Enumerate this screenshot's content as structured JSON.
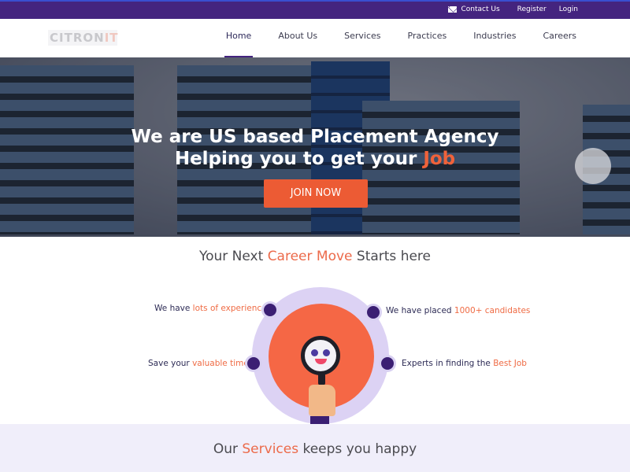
{
  "topbar": {
    "contact_label": "Contact Us",
    "register_label": "Register",
    "login_label": "Login"
  },
  "nav": {
    "logo_main": "CITRON",
    "logo_accent": "IT",
    "items": [
      {
        "label": "Home",
        "active": true
      },
      {
        "label": "About Us"
      },
      {
        "label": "Services"
      },
      {
        "label": "Practices"
      },
      {
        "label": "Industries"
      },
      {
        "label": "Careers"
      }
    ]
  },
  "hero": {
    "line1": "We are US based Placement Agency",
    "line2_prefix": "Helping you to get your ",
    "line2_accent": "Job",
    "cta_label": "JOIN NOW"
  },
  "career": {
    "title_prefix": "Your Next ",
    "title_accent": "Career Move",
    "title_suffix": " Starts here",
    "features": [
      {
        "prefix": "We have ",
        "accent": "lots of experience"
      },
      {
        "prefix": "We have placed ",
        "accent": "1000+ candidates"
      },
      {
        "prefix": "Save your ",
        "accent": "valuable time"
      },
      {
        "prefix": "Experts in finding the ",
        "accent": "Best Job"
      }
    ]
  },
  "services": {
    "title_prefix": "Our ",
    "title_accent": "Services",
    "title_suffix": " keeps you happy"
  },
  "colors": {
    "brand_purple": "#44247f",
    "accent_orange": "#ec5b34",
    "ring_lavender": "#dcd2f4"
  }
}
